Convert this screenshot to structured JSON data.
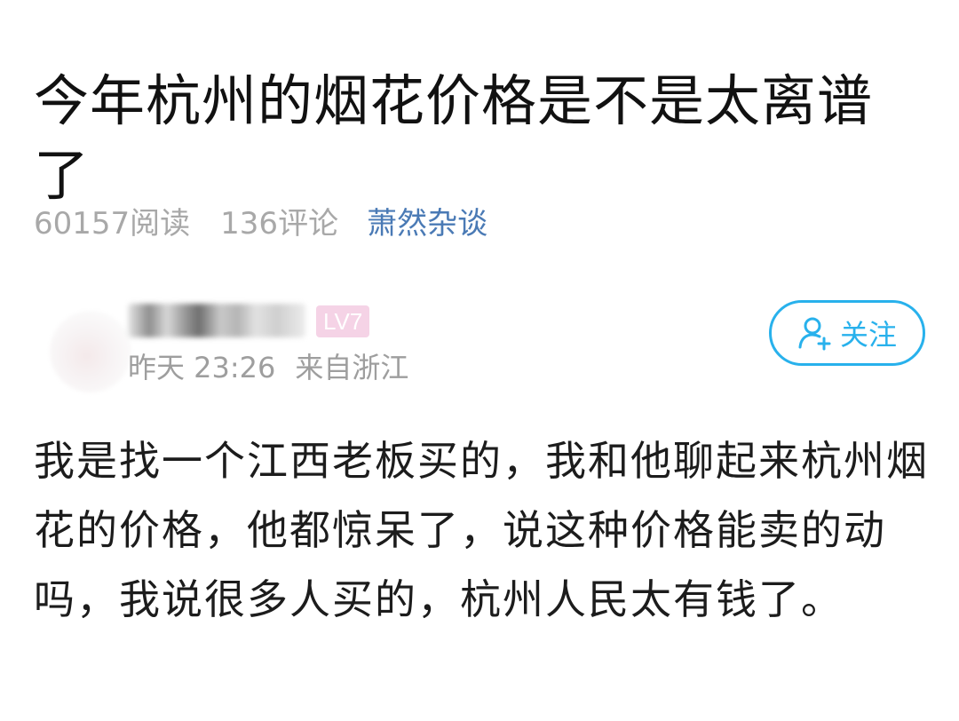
{
  "post": {
    "title": "今年杭州的烟花价格是不是太离谱了",
    "reads": "60157阅读",
    "comments": "136评论",
    "channel": "萧然杂谈"
  },
  "author": {
    "level": "LV7",
    "time": "昨天 23:26",
    "location": "来自浙江",
    "follow_label": "关注"
  },
  "body": {
    "text": "我是找一个江西老板买的，我和他聊起来杭州烟花的价格，他都惊呆了，说这种价格能卖的动吗，我说很多人买的，杭州人民太有钱了。"
  },
  "colors": {
    "accent": "#28b1ec",
    "channel": "#4a7ab5",
    "badge": "#f5d3e6"
  },
  "icons": {
    "follow": "add-user-icon"
  }
}
